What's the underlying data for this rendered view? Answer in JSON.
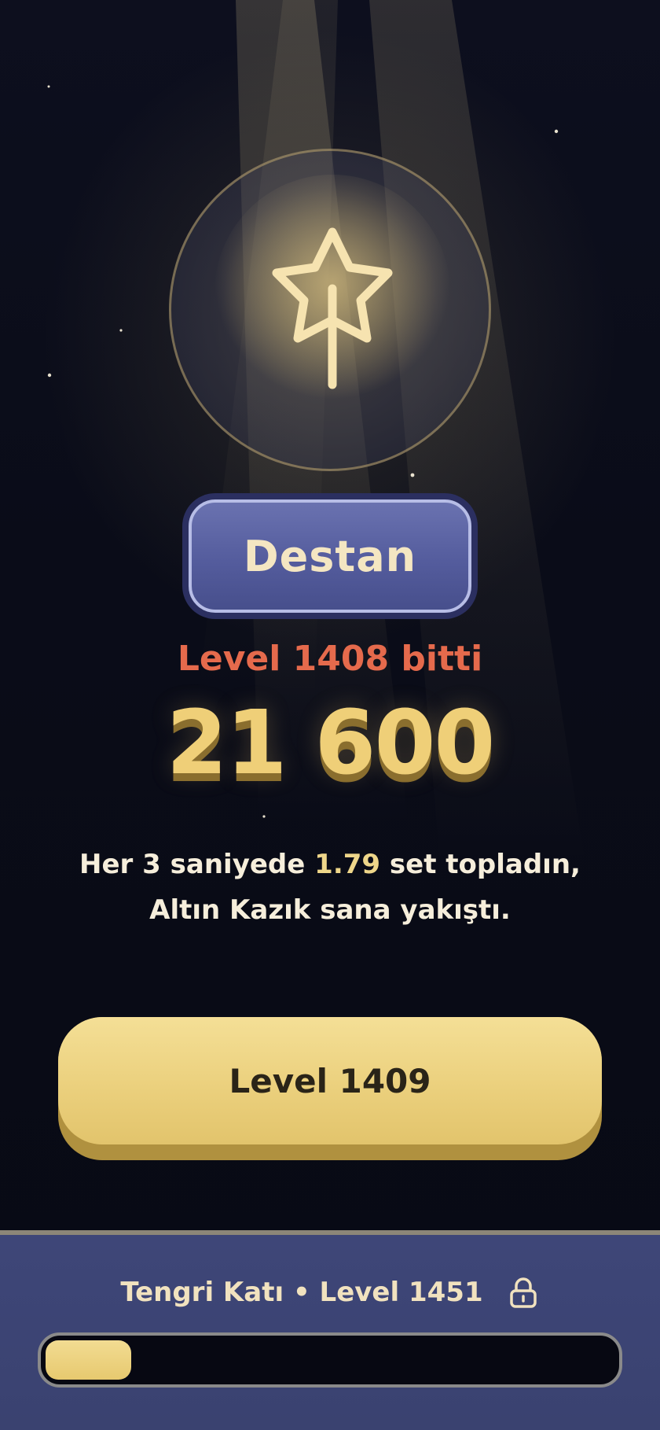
{
  "rank": {
    "label": "Destan",
    "icon": "star-wand-icon"
  },
  "result": {
    "level_finished": "Level 1408 bitti",
    "score": "21 600"
  },
  "message": {
    "line1_prefix": "Her 3 saniyede ",
    "line1_value": "1.79",
    "line1_suffix": " set topladın,",
    "line2": "Altın Kazık sana yakıştı."
  },
  "next_button": {
    "label": "Level 1409"
  },
  "footer": {
    "unlock_text": "Tengri Katı • Level 1451",
    "lock_icon": "lock-icon",
    "progress_fraction": 0.15
  },
  "colors": {
    "background": "#0a0c18",
    "gold": "#efcf78",
    "accent_red": "#e56a4c",
    "rank_blue": "#545c9d",
    "footer_blue": "#3e4678"
  }
}
